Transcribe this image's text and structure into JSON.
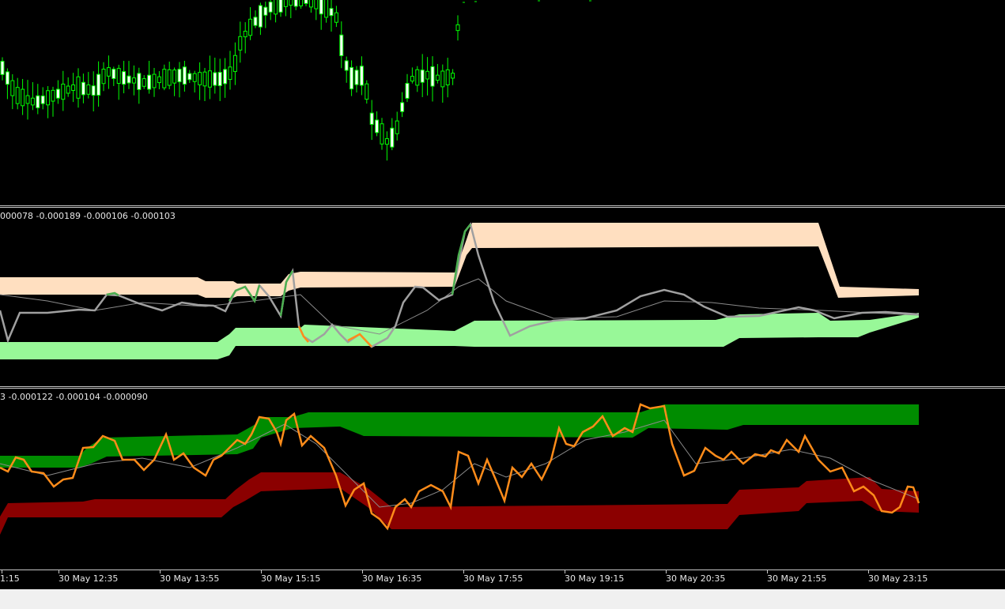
{
  "colors": {
    "background": "#000000",
    "candle_up": "#00ff00",
    "candle_down": "#ffffff",
    "band_upper_ind1": "#ffdfc0",
    "band_lower_ind1": "#98f898",
    "band_upper_ind2": "#008c00",
    "band_lower_ind2": "#8b0000",
    "line_gray": "#a0a0a0",
    "line_green": "#4caf50",
    "line_orange": "#ff8c1a",
    "axis_text": "#e6e6e6",
    "separator": "#c8c8c8"
  },
  "panes": {
    "main": {
      "name": "price-chart"
    },
    "ind1": {
      "label": "000078 -0.000189 -0.000106 -0.000103"
    },
    "ind2": {
      "label": "3 -0.000122 -0.000104 -0.000090"
    }
  },
  "time_axis": {
    "labels": [
      "1:15",
      "30 May 12:35",
      "30 May 13:55",
      "30 May 15:15",
      "30 May 16:35",
      "30 May 17:55",
      "30 May 19:15",
      "30 May 20:35",
      "30 May 21:55",
      "30 May 23:15"
    ]
  },
  "icons": {
    "candles": "candlestick-bars"
  }
}
